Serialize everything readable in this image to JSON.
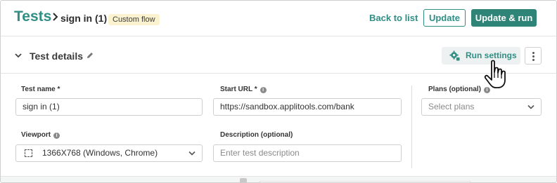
{
  "header": {
    "root": "Tests",
    "current": "sign in (1)",
    "badge": "Custom flow",
    "back_link": "Back to list",
    "update_button": "Update",
    "update_run_button": "Update & run"
  },
  "section": {
    "title": "Test details",
    "run_settings_label": "Run settings"
  },
  "form": {
    "test_name": {
      "label": "Test name *",
      "value": "sign in (1)"
    },
    "start_url": {
      "label": "Start URL *",
      "value": "https://sandbox.applitools.com/bank"
    },
    "plans": {
      "label": "Plans (optional)",
      "placeholder": "Select plans"
    },
    "viewport": {
      "label": "Viewport",
      "value": "1366X768 (Windows, Chrome)"
    },
    "description": {
      "label": "Description (optional)",
      "placeholder": "Enter test description"
    }
  },
  "icons": {
    "info": "i",
    "separator": "chevron-right-icon",
    "collapse": "chevron-down-icon",
    "edit": "pencil-icon",
    "run_settings": "gear-icon",
    "more": "kebab-menu-icon",
    "viewport": "viewport-icon",
    "cursor": "hand-pointer-icon"
  },
  "colors": {
    "brand": "#2f8f84",
    "brand_dark": "#2f8478",
    "badge_bg": "#fbf3cf",
    "run_settings_bg": "#eef1f1"
  }
}
